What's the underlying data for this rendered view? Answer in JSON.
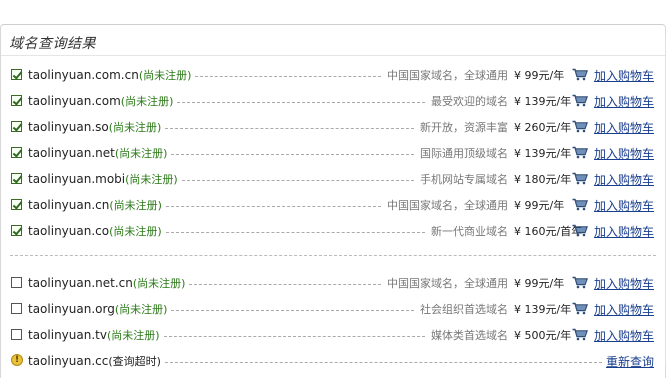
{
  "panel": {
    "title": "域名查询结果",
    "retry_label": "重新查询",
    "add_cart_label": "加入购物车"
  },
  "colors": {
    "available": "#2b7a18",
    "link": "#1a3f8f",
    "muted": "#777777"
  },
  "results": [
    {
      "domain": "taolinyuan.com.cn",
      "status": "(尚未注册)",
      "desc": "中国国家域名，全球通用",
      "price": "¥ 99元/年",
      "checked": true
    },
    {
      "domain": "taolinyuan.com",
      "status": "(尚未注册)",
      "desc": "最受欢迎的域名",
      "price": "¥ 139元/年",
      "checked": true
    },
    {
      "domain": "taolinyuan.so",
      "status": "(尚未注册)",
      "desc": "新开放，资源丰富",
      "price": "¥ 260元/年",
      "checked": true
    },
    {
      "domain": "taolinyuan.net",
      "status": "(尚未注册)",
      "desc": "国际通用顶级域名",
      "price": "¥ 139元/年",
      "checked": true
    },
    {
      "domain": "taolinyuan.mobi",
      "status": "(尚未注册)",
      "desc": "手机网站专属域名",
      "price": "¥ 180元/年",
      "checked": true
    },
    {
      "domain": "taolinyuan.cn",
      "status": "(尚未注册)",
      "desc": "中国国家域名，全球通用",
      "price": "¥ 99元/年",
      "checked": true
    },
    {
      "domain": "taolinyuan.co",
      "status": "(尚未注册)",
      "desc": "新一代商业域名",
      "price": "¥ 160元/首年",
      "checked": true
    },
    {
      "domain": "taolinyuan.net.cn",
      "status": "(尚未注册)",
      "desc": "中国国家域名，全球通用",
      "price": "¥ 99元/年",
      "checked": false
    },
    {
      "domain": "taolinyuan.org",
      "status": "(尚未注册)",
      "desc": "社会组织首选域名",
      "price": "¥ 139元/年",
      "checked": false
    },
    {
      "domain": "taolinyuan.tv",
      "status": "(尚未注册)",
      "desc": "媒体类首选域名",
      "price": "¥ 500元/年",
      "checked": false
    },
    {
      "domain": "taolinyuan.cc",
      "status": "(查询超时)",
      "timeout": true
    }
  ],
  "icons": {
    "cart": "cart-icon",
    "warning": "warning-icon",
    "checkbox": "checkbox"
  }
}
